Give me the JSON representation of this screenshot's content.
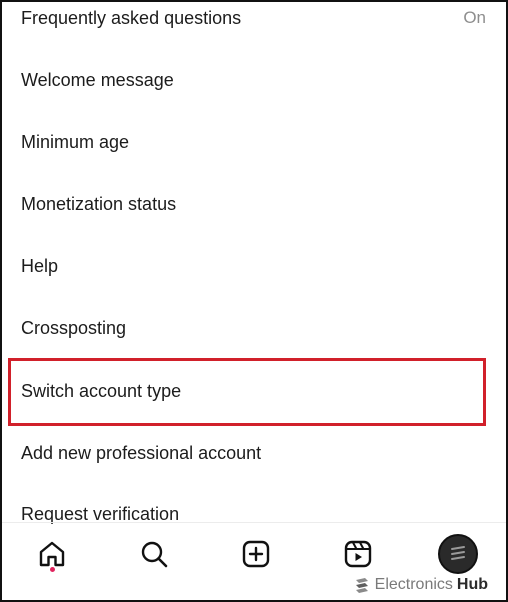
{
  "settings": {
    "items": [
      {
        "label": "Frequently asked questions",
        "value": "On"
      },
      {
        "label": "Welcome message"
      },
      {
        "label": "Minimum age"
      },
      {
        "label": "Monetization status"
      },
      {
        "label": "Help"
      },
      {
        "label": "Crossposting"
      },
      {
        "label": "Switch account type"
      },
      {
        "label": "Add new professional account"
      },
      {
        "label": "Request verification"
      }
    ]
  },
  "nav": {
    "items": [
      "home-icon",
      "search-icon",
      "create-post-icon",
      "reels-icon",
      "profile-avatar"
    ]
  },
  "watermark": {
    "part1": "Electronics",
    "part2": "Hub"
  },
  "colors": {
    "highlight": "#d1202a",
    "notification_dot": "#e0245e"
  }
}
